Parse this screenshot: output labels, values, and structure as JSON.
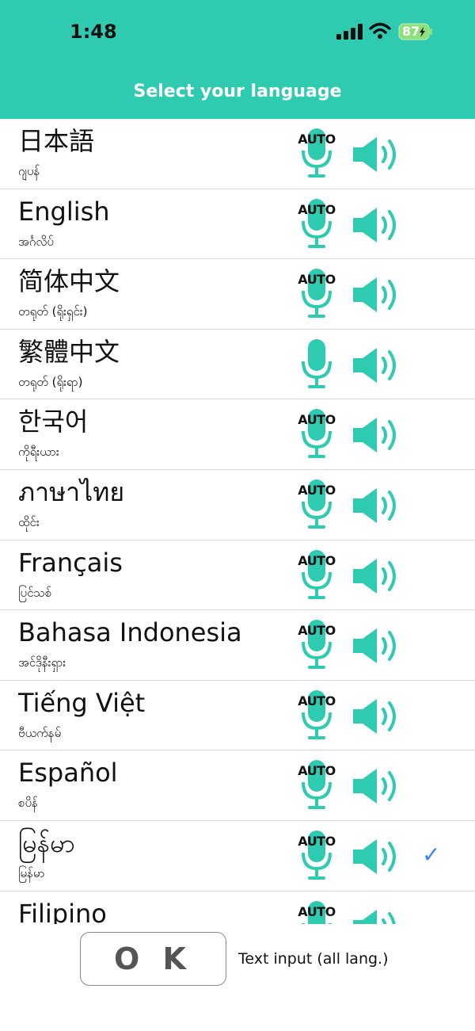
{
  "status": {
    "time": "1:48",
    "battery": "87"
  },
  "header": {
    "title": "Select your language"
  },
  "languages": [
    {
      "name": "日本語",
      "sub": "ဂျပန်",
      "auto": "AUTO"
    },
    {
      "name": "English",
      "sub": "အင်္ဂလိပ်",
      "auto": "AUTO"
    },
    {
      "name": "简体中文",
      "sub": "တရုတ် (ရိုးရှင်း)",
      "auto": "AUTO"
    },
    {
      "name": "繁體中文",
      "sub": "တရုတ် (ရိုးရာ)",
      "auto": ""
    },
    {
      "name": "한국어",
      "sub": "ကိုရီးယား",
      "auto": "AUTO"
    },
    {
      "name": "ภาษาไทย",
      "sub": "ထိုင်း",
      "auto": "AUTO"
    },
    {
      "name": "Français",
      "sub": "ပြင်သစ်",
      "auto": "AUTO"
    },
    {
      "name": "Bahasa Indonesia",
      "sub": "အင်ဒိုနီးရှား",
      "auto": "AUTO"
    },
    {
      "name": "Tiếng Việt",
      "sub": "ဗီယက်နမ်",
      "auto": "AUTO"
    },
    {
      "name": "Español",
      "sub": "စပိန်",
      "auto": "AUTO"
    },
    {
      "name": "မြန်မာ",
      "sub": "မြန်မာ",
      "auto": "AUTO",
      "selected": true
    },
    {
      "name": "Filipino",
      "sub": "",
      "auto": "AUTO"
    }
  ],
  "footer": {
    "ok_label": "O K",
    "text_input_label": "Text input (all lang.)"
  },
  "colors": {
    "accent": "#2ecbb1",
    "check": "#3b82f6"
  },
  "icons": {
    "mic": "microphone-icon",
    "speaker": "speaker-icon",
    "check": "checkmark-icon"
  }
}
